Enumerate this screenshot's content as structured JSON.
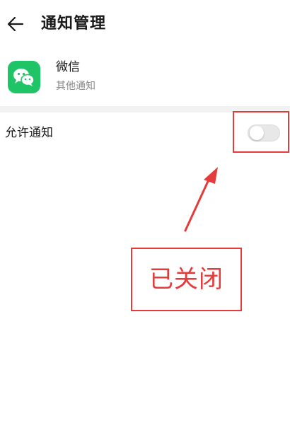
{
  "header": {
    "back_icon": "arrow-left-icon",
    "title": "通知管理"
  },
  "app": {
    "icon": "wechat-icon",
    "icon_color": "#1fc466",
    "name": "微信",
    "subtitle": "其他通知"
  },
  "settings": {
    "allow_notifications": {
      "label": "允许通知",
      "enabled": false
    }
  },
  "annotation": {
    "callout_text": "已关闭",
    "color": "#e53b3b"
  }
}
